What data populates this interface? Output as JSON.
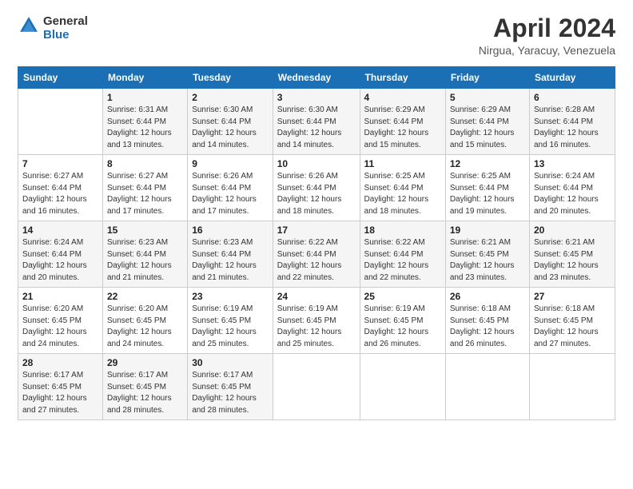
{
  "header": {
    "logo_line1": "General",
    "logo_line2": "Blue",
    "month_title": "April 2024",
    "location": "Nirgua, Yaracuy, Venezuela"
  },
  "weekdays": [
    "Sunday",
    "Monday",
    "Tuesday",
    "Wednesday",
    "Thursday",
    "Friday",
    "Saturday"
  ],
  "weeks": [
    [
      {
        "day": "",
        "sunrise": "",
        "sunset": "",
        "daylight": ""
      },
      {
        "day": "1",
        "sunrise": "Sunrise: 6:31 AM",
        "sunset": "Sunset: 6:44 PM",
        "daylight": "Daylight: 12 hours and 13 minutes."
      },
      {
        "day": "2",
        "sunrise": "Sunrise: 6:30 AM",
        "sunset": "Sunset: 6:44 PM",
        "daylight": "Daylight: 12 hours and 14 minutes."
      },
      {
        "day": "3",
        "sunrise": "Sunrise: 6:30 AM",
        "sunset": "Sunset: 6:44 PM",
        "daylight": "Daylight: 12 hours and 14 minutes."
      },
      {
        "day": "4",
        "sunrise": "Sunrise: 6:29 AM",
        "sunset": "Sunset: 6:44 PM",
        "daylight": "Daylight: 12 hours and 15 minutes."
      },
      {
        "day": "5",
        "sunrise": "Sunrise: 6:29 AM",
        "sunset": "Sunset: 6:44 PM",
        "daylight": "Daylight: 12 hours and 15 minutes."
      },
      {
        "day": "6",
        "sunrise": "Sunrise: 6:28 AM",
        "sunset": "Sunset: 6:44 PM",
        "daylight": "Daylight: 12 hours and 16 minutes."
      }
    ],
    [
      {
        "day": "7",
        "sunrise": "Sunrise: 6:27 AM",
        "sunset": "Sunset: 6:44 PM",
        "daylight": "Daylight: 12 hours and 16 minutes."
      },
      {
        "day": "8",
        "sunrise": "Sunrise: 6:27 AM",
        "sunset": "Sunset: 6:44 PM",
        "daylight": "Daylight: 12 hours and 17 minutes."
      },
      {
        "day": "9",
        "sunrise": "Sunrise: 6:26 AM",
        "sunset": "Sunset: 6:44 PM",
        "daylight": "Daylight: 12 hours and 17 minutes."
      },
      {
        "day": "10",
        "sunrise": "Sunrise: 6:26 AM",
        "sunset": "Sunset: 6:44 PM",
        "daylight": "Daylight: 12 hours and 18 minutes."
      },
      {
        "day": "11",
        "sunrise": "Sunrise: 6:25 AM",
        "sunset": "Sunset: 6:44 PM",
        "daylight": "Daylight: 12 hours and 18 minutes."
      },
      {
        "day": "12",
        "sunrise": "Sunrise: 6:25 AM",
        "sunset": "Sunset: 6:44 PM",
        "daylight": "Daylight: 12 hours and 19 minutes."
      },
      {
        "day": "13",
        "sunrise": "Sunrise: 6:24 AM",
        "sunset": "Sunset: 6:44 PM",
        "daylight": "Daylight: 12 hours and 20 minutes."
      }
    ],
    [
      {
        "day": "14",
        "sunrise": "Sunrise: 6:24 AM",
        "sunset": "Sunset: 6:44 PM",
        "daylight": "Daylight: 12 hours and 20 minutes."
      },
      {
        "day": "15",
        "sunrise": "Sunrise: 6:23 AM",
        "sunset": "Sunset: 6:44 PM",
        "daylight": "Daylight: 12 hours and 21 minutes."
      },
      {
        "day": "16",
        "sunrise": "Sunrise: 6:23 AM",
        "sunset": "Sunset: 6:44 PM",
        "daylight": "Daylight: 12 hours and 21 minutes."
      },
      {
        "day": "17",
        "sunrise": "Sunrise: 6:22 AM",
        "sunset": "Sunset: 6:44 PM",
        "daylight": "Daylight: 12 hours and 22 minutes."
      },
      {
        "day": "18",
        "sunrise": "Sunrise: 6:22 AM",
        "sunset": "Sunset: 6:44 PM",
        "daylight": "Daylight: 12 hours and 22 minutes."
      },
      {
        "day": "19",
        "sunrise": "Sunrise: 6:21 AM",
        "sunset": "Sunset: 6:45 PM",
        "daylight": "Daylight: 12 hours and 23 minutes."
      },
      {
        "day": "20",
        "sunrise": "Sunrise: 6:21 AM",
        "sunset": "Sunset: 6:45 PM",
        "daylight": "Daylight: 12 hours and 23 minutes."
      }
    ],
    [
      {
        "day": "21",
        "sunrise": "Sunrise: 6:20 AM",
        "sunset": "Sunset: 6:45 PM",
        "daylight": "Daylight: 12 hours and 24 minutes."
      },
      {
        "day": "22",
        "sunrise": "Sunrise: 6:20 AM",
        "sunset": "Sunset: 6:45 PM",
        "daylight": "Daylight: 12 hours and 24 minutes."
      },
      {
        "day": "23",
        "sunrise": "Sunrise: 6:19 AM",
        "sunset": "Sunset: 6:45 PM",
        "daylight": "Daylight: 12 hours and 25 minutes."
      },
      {
        "day": "24",
        "sunrise": "Sunrise: 6:19 AM",
        "sunset": "Sunset: 6:45 PM",
        "daylight": "Daylight: 12 hours and 25 minutes."
      },
      {
        "day": "25",
        "sunrise": "Sunrise: 6:19 AM",
        "sunset": "Sunset: 6:45 PM",
        "daylight": "Daylight: 12 hours and 26 minutes."
      },
      {
        "day": "26",
        "sunrise": "Sunrise: 6:18 AM",
        "sunset": "Sunset: 6:45 PM",
        "daylight": "Daylight: 12 hours and 26 minutes."
      },
      {
        "day": "27",
        "sunrise": "Sunrise: 6:18 AM",
        "sunset": "Sunset: 6:45 PM",
        "daylight": "Daylight: 12 hours and 27 minutes."
      }
    ],
    [
      {
        "day": "28",
        "sunrise": "Sunrise: 6:17 AM",
        "sunset": "Sunset: 6:45 PM",
        "daylight": "Daylight: 12 hours and 27 minutes."
      },
      {
        "day": "29",
        "sunrise": "Sunrise: 6:17 AM",
        "sunset": "Sunset: 6:45 PM",
        "daylight": "Daylight: 12 hours and 28 minutes."
      },
      {
        "day": "30",
        "sunrise": "Sunrise: 6:17 AM",
        "sunset": "Sunset: 6:45 PM",
        "daylight": "Daylight: 12 hours and 28 minutes."
      },
      {
        "day": "",
        "sunrise": "",
        "sunset": "",
        "daylight": ""
      },
      {
        "day": "",
        "sunrise": "",
        "sunset": "",
        "daylight": ""
      },
      {
        "day": "",
        "sunrise": "",
        "sunset": "",
        "daylight": ""
      },
      {
        "day": "",
        "sunrise": "",
        "sunset": "",
        "daylight": ""
      }
    ]
  ]
}
